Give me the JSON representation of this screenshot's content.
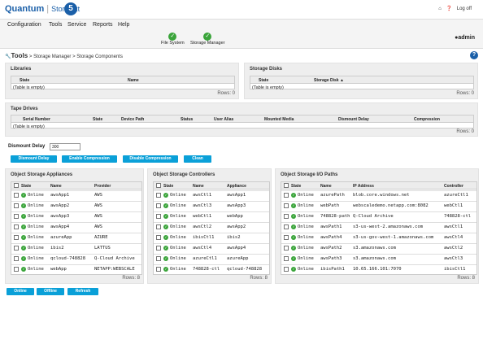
{
  "header": {
    "brand": "Quantum",
    "sep": "|",
    "product": "StorNext",
    "badge": "5",
    "home_icon": "home-icon",
    "help_icon": "help-icon",
    "logoff": "Log off"
  },
  "menu": [
    "Configuration",
    "Tools",
    "Service",
    "Reports",
    "Help"
  ],
  "status": {
    "fs": "File System",
    "sm": "Storage Manager",
    "admin": "admin"
  },
  "breadcrumb": {
    "tools": "Tools",
    "path": " > Storage Manager > Storage Components"
  },
  "libraries": {
    "title": "Libraries",
    "cols": [
      "State",
      "Name"
    ],
    "empty": "(Table is empty)",
    "rows": "Rows: 0"
  },
  "disks": {
    "title": "Storage Disks",
    "cols": [
      "State",
      "Storage Disk ▲"
    ],
    "empty": "(Table is empty)",
    "rows": "Rows: 0"
  },
  "tapes": {
    "title": "Tape Drives",
    "cols": [
      "Serial Number",
      "State",
      "Device Path",
      "Status",
      "User Alias",
      "Mounted Media",
      "Dismount Delay",
      "Compression"
    ],
    "empty": "(Table is empty)",
    "rows": "Rows: 0"
  },
  "dismount": {
    "label": "Dismount Delay",
    "value": "300"
  },
  "buttons": [
    "Dismount Delay",
    "Enable Compression",
    "Disable Compression",
    "Clean"
  ],
  "appliances": {
    "title": "Object Storage Appliances",
    "cols": [
      "State",
      "Name",
      "Provider"
    ],
    "rows": [
      [
        "Online",
        "awsApp1",
        "AWS"
      ],
      [
        "Online",
        "awsApp2",
        "AWS"
      ],
      [
        "Online",
        "awsApp3",
        "AWS"
      ],
      [
        "Online",
        "awsApp4",
        "AWS"
      ],
      [
        "Online",
        "azureApp",
        "AZURE"
      ],
      [
        "Online",
        "ibis2",
        "LATTUS"
      ],
      [
        "Online",
        "qcloud-748828",
        "Q-Cloud Archive"
      ],
      [
        "Online",
        "webApp",
        "NETAPP:WEBSCALE"
      ]
    ],
    "count": "Rows: 8"
  },
  "controllers": {
    "title": "Object Storage Controllers",
    "cols": [
      "State",
      "Name",
      "Appliance"
    ],
    "rows": [
      [
        "Online",
        "awsCtl1",
        "awsApp1"
      ],
      [
        "Online",
        "awsCtl3",
        "awsApp3"
      ],
      [
        "Online",
        "webCtl1",
        "webApp"
      ],
      [
        "Online",
        "awsCtl2",
        "awsApp2"
      ],
      [
        "Online",
        "ibisCtl1",
        "ibis2"
      ],
      [
        "Online",
        "awsCtl4",
        "awsApp4"
      ],
      [
        "Online",
        "azureCtl1",
        "azureApp"
      ],
      [
        "Online",
        "748828-ctl",
        "qcloud-748828"
      ]
    ],
    "count": "Rows: 8"
  },
  "paths": {
    "title": "Object Storage I/O Paths",
    "cols": [
      "State",
      "Name",
      "IP Address",
      "Controller"
    ],
    "rows": [
      [
        "Online",
        "azurePath",
        "blob.core.windows.net",
        "azureCtl1"
      ],
      [
        "Online",
        "webPath",
        "webscaledemo.netapp.com:8082",
        "webCtl1"
      ],
      [
        "Online",
        "748828-path",
        "Q-Cloud Archive",
        "748828-ctl"
      ],
      [
        "Online",
        "awsPath1",
        "s3-us-west-2.amazonaws.com",
        "awsCtl1"
      ],
      [
        "Online",
        "awsPath4",
        "s3-us-gov-west-1.amazonaws.com",
        "awsCtl4"
      ],
      [
        "Online",
        "awsPath2",
        "s3.amazonaws.com",
        "awsCtl2"
      ],
      [
        "Online",
        "awsPath3",
        "s3.amazonaws.com",
        "awsCtl3"
      ],
      [
        "Online",
        "ibisPath1",
        "10.65.166.101:7070",
        "ibisCtl1"
      ]
    ],
    "count": "Rows: 8"
  },
  "bottom_buttons": [
    "Online",
    "Offline",
    "Refresh"
  ],
  "colors": {
    "accent": "#0aa0d8",
    "brand": "#1a5fa8",
    "ok": "#3aa43a"
  }
}
